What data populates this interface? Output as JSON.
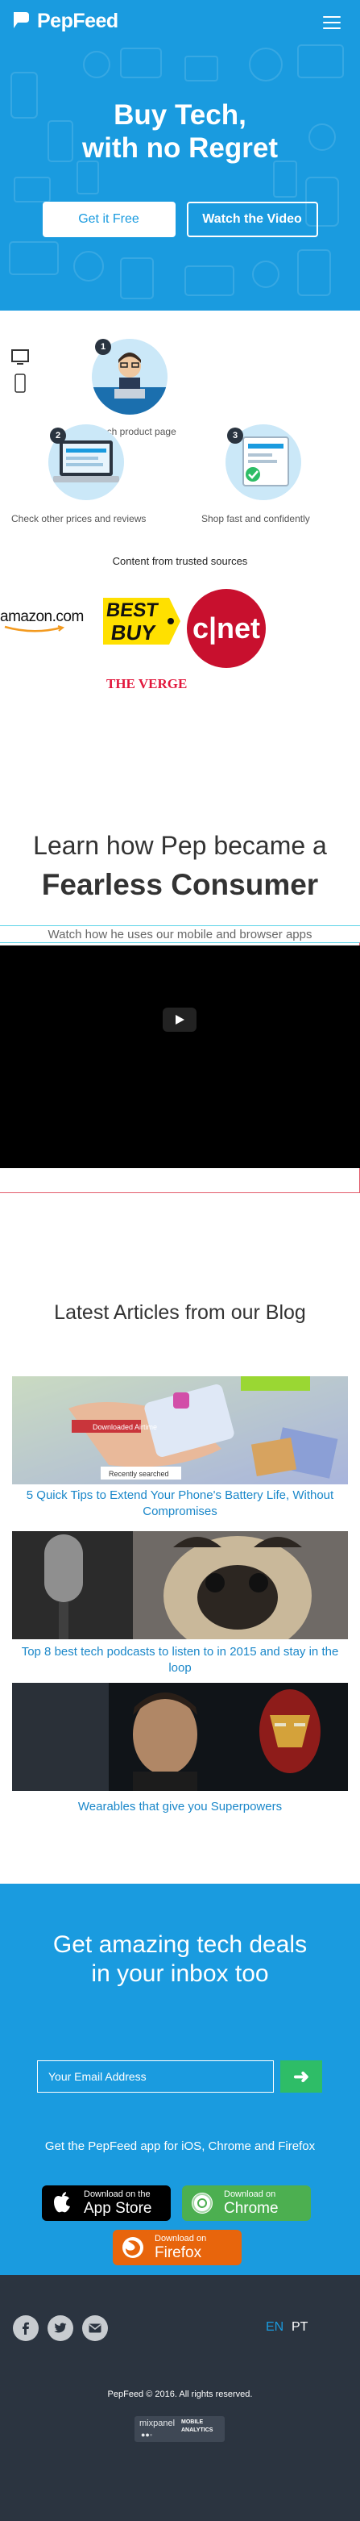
{
  "brand": {
    "name": "PepFeed"
  },
  "hero": {
    "title_line1": "Buy Tech,",
    "title_line2": "with no Regret",
    "btn_primary": "Get it Free",
    "btn_secondary": "Watch the Video"
  },
  "steps": [
    {
      "num": "1",
      "label": "ech product page"
    },
    {
      "num": "2",
      "label": "Check other prices and reviews"
    },
    {
      "num": "3",
      "label": "Shop fast and confidently"
    }
  ],
  "trusted": {
    "heading": "Content from trusted sources",
    "logos": {
      "amazon": "amazon.com",
      "bestbuy_1": "BEST",
      "bestbuy_2": "BUY",
      "cnet": "c|net",
      "verge": "THE VERGE"
    }
  },
  "learn": {
    "line1": "Learn how Pep became a",
    "line2": "Fearless Consumer",
    "subtitle": "Watch how he uses our mobile and browser apps"
  },
  "blog": {
    "heading": "Latest Articles from our Blog",
    "articles": [
      {
        "title": "5 Quick Tips to Extend Your Phone's Battery Life, Without Compromises",
        "img_text_1": "Downloaded Airtime",
        "img_text_2": "Recently searched"
      },
      {
        "title": "Top 8 best tech podcasts to listen to in 2015 and stay in the loop"
      },
      {
        "title": "Wearables that give you Superpowers"
      }
    ]
  },
  "newsletter": {
    "title_line1": "Get amazing tech deals",
    "title_line2": "in your inbox too",
    "email_placeholder": "Your Email Address",
    "submit_glyph": "➜",
    "get_app": "Get the PepFeed app for iOS, Chrome and Firefox",
    "stores": [
      {
        "small": "Download on the",
        "large": "App Store"
      },
      {
        "small": "Download on",
        "large": "Chrome"
      },
      {
        "small": "Download on",
        "large": "Firefox"
      }
    ]
  },
  "footer": {
    "lang_en": "EN",
    "lang_pt": "PT",
    "copyright": "PepFeed © 2016. All rights reserved.",
    "mixpanel": "mixpanel",
    "mixpanel_sub_1": "MOBILE",
    "mixpanel_sub_2": "ANALYTICS"
  },
  "colors": {
    "brand_blue": "#1a9bdf",
    "footer_dark": "#2b3440",
    "submit_green": "#2ebd67",
    "link_blue": "#1a87c9",
    "appstore_black": "#000000",
    "chrome_green": "#4caf50",
    "firefox_orange": "#e8650c"
  }
}
